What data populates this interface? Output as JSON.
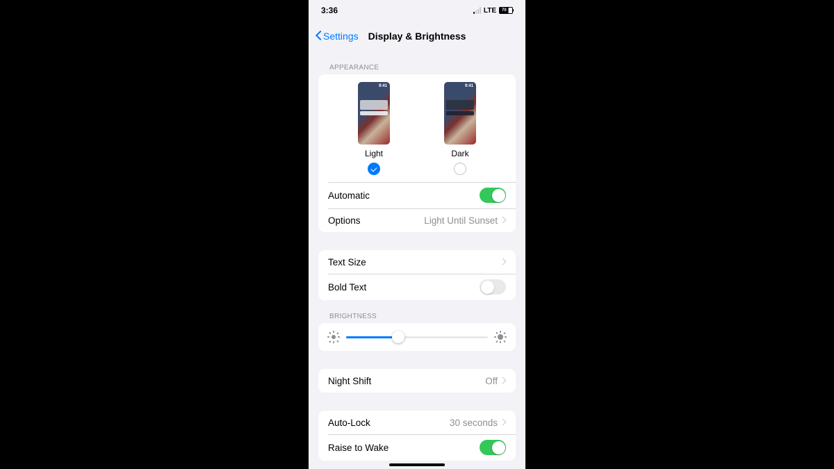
{
  "status": {
    "time": "3:36",
    "network": "LTE",
    "battery": "70"
  },
  "nav": {
    "back": "Settings",
    "title": "Display & Brightness"
  },
  "appearance": {
    "header": "APPEARANCE",
    "options": [
      {
        "label": "Light",
        "time": "9:41",
        "selected": true
      },
      {
        "label": "Dark",
        "time": "9:41",
        "selected": false
      }
    ],
    "automatic": {
      "label": "Automatic",
      "on": true
    },
    "options_row": {
      "label": "Options",
      "value": "Light Until Sunset"
    }
  },
  "text_group": {
    "text_size": {
      "label": "Text Size"
    },
    "bold_text": {
      "label": "Bold Text",
      "on": false
    }
  },
  "brightness": {
    "header": "BRIGHTNESS",
    "value_pct": 37
  },
  "night_shift": {
    "label": "Night Shift",
    "value": "Off"
  },
  "lock_group": {
    "auto_lock": {
      "label": "Auto-Lock",
      "value": "30 seconds"
    },
    "raise_to_wake": {
      "label": "Raise to Wake",
      "on": true
    }
  }
}
